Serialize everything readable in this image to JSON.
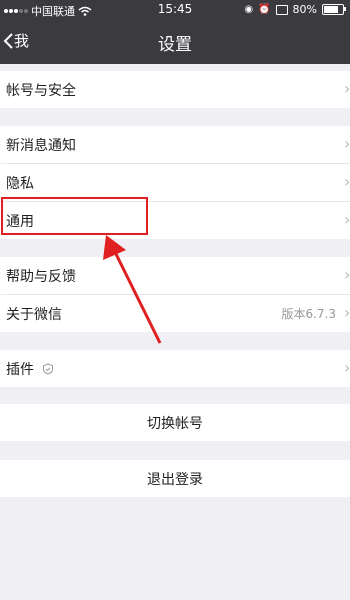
{
  "status_bar": {
    "carrier": "中国联通",
    "time": "15:45",
    "battery": "80%"
  },
  "nav": {
    "back_label": "我",
    "title": "设置"
  },
  "settings": {
    "account_security": "帐号与安全",
    "new_message_notification": "新消息通知",
    "privacy": "隐私",
    "general": "通用",
    "help_feedback": "帮助与反馈",
    "about": "关于微信",
    "about_version": "版本6.7.3",
    "plugins": "插件",
    "switch_account": "切换帐号",
    "logout": "退出登录"
  },
  "annotation": {
    "color": "#e02020",
    "highlighted_item": "通用"
  },
  "colors": {
    "nav_background": "#3a3a3f",
    "page_background": "#efeff4"
  }
}
